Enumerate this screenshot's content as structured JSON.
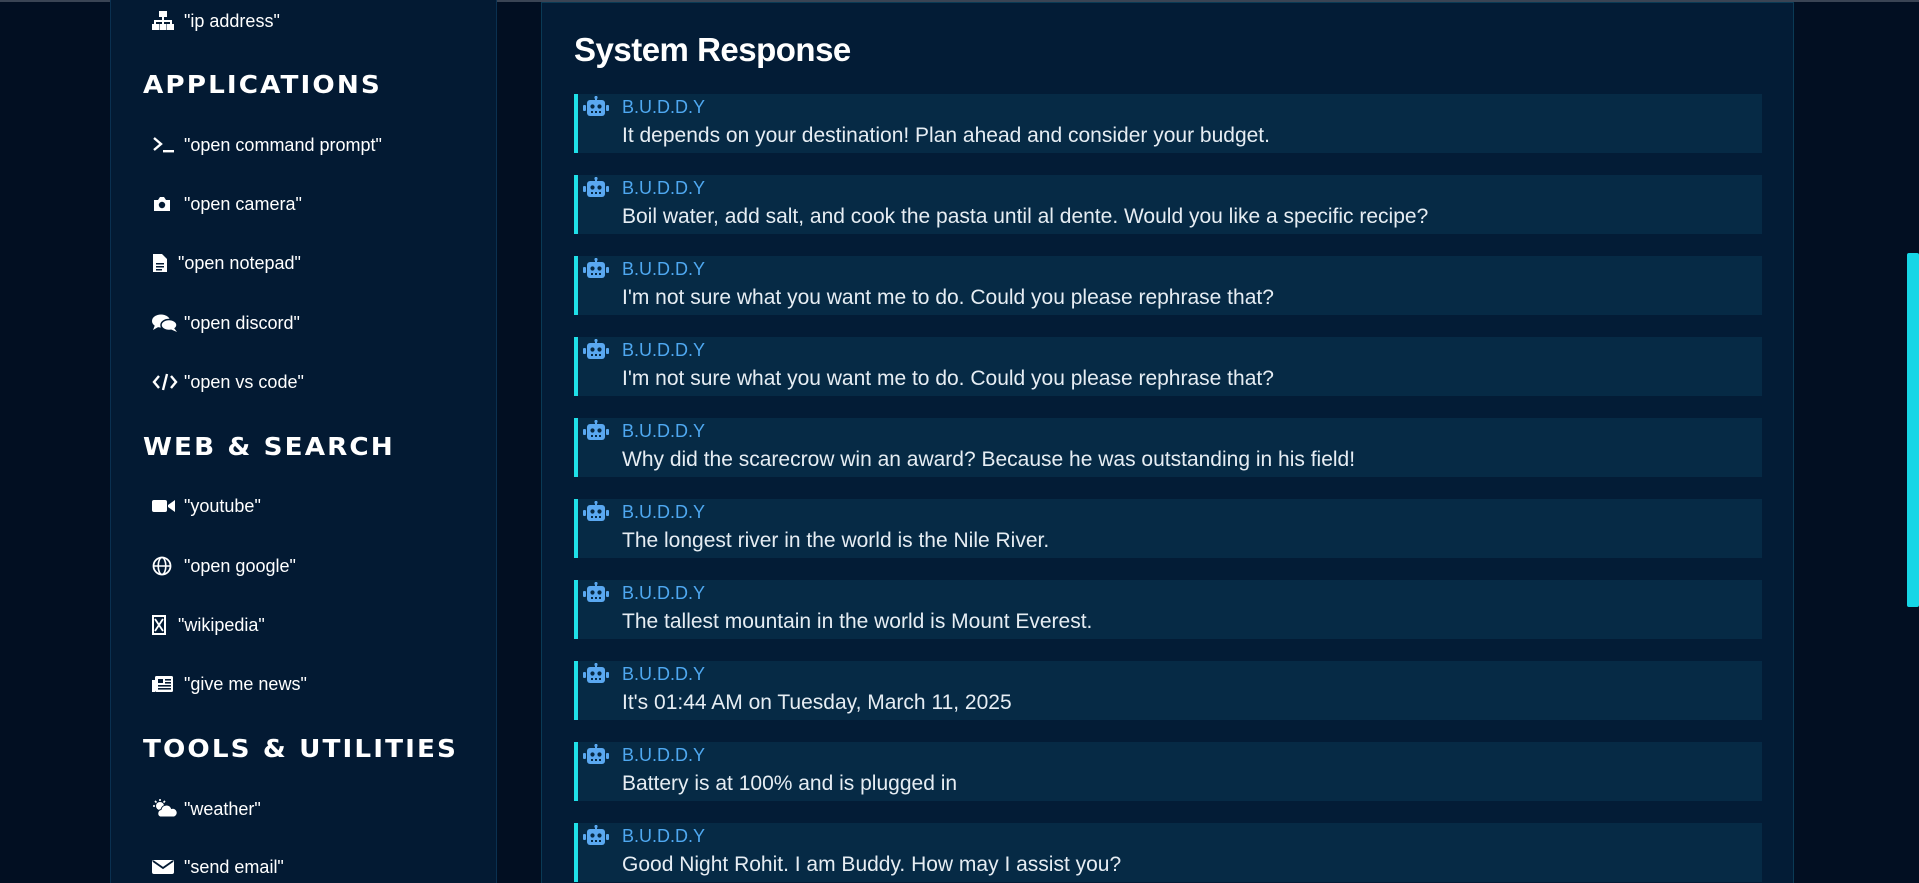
{
  "sidebar": {
    "top_item": {
      "label": "\"ip address\"",
      "icon": "network-icon"
    },
    "sections": [
      {
        "title": "APPLICATIONS",
        "items": [
          {
            "label": "\"open command prompt\"",
            "icon": "terminal-icon"
          },
          {
            "label": "\"open camera\"",
            "icon": "camera-icon"
          },
          {
            "label": "\"open notepad\"",
            "icon": "file-icon"
          },
          {
            "label": "\"open discord\"",
            "icon": "comments-icon"
          },
          {
            "label": "\"open vs code\"",
            "icon": "code-icon"
          }
        ]
      },
      {
        "title": "WEB & SEARCH",
        "items": [
          {
            "label": "\"youtube\"",
            "icon": "video-icon"
          },
          {
            "label": "\"open google\"",
            "icon": "globe-icon"
          },
          {
            "label": "\"wikipedia\"",
            "icon": "wikipedia-icon"
          },
          {
            "label": "\"give me news\"",
            "icon": "newspaper-icon"
          }
        ]
      },
      {
        "title": "TOOLS & UTILITIES",
        "items": [
          {
            "label": "\"weather\"",
            "icon": "cloud-sun-icon"
          },
          {
            "label": "\"send email\"",
            "icon": "envelope-icon"
          }
        ]
      }
    ]
  },
  "main": {
    "title": "System Response",
    "sender_name": "B.U.D.D.Y",
    "messages": [
      {
        "sender": "B.U.D.D.Y",
        "text": "It depends on your destination! Plan ahead and consider your budget."
      },
      {
        "sender": "B.U.D.D.Y",
        "text": "Boil water, add salt, and cook the pasta until al dente. Would you like a specific recipe?"
      },
      {
        "sender": "B.U.D.D.Y",
        "text": "I'm not sure what you want me to do. Could you please rephrase that?"
      },
      {
        "sender": "B.U.D.D.Y",
        "text": "I'm not sure what you want me to do. Could you please rephrase that?"
      },
      {
        "sender": "B.U.D.D.Y",
        "text": "Why did the scarecrow win an award? Because he was outstanding in his field!"
      },
      {
        "sender": "B.U.D.D.Y",
        "text": "The longest river in the world is the Nile River."
      },
      {
        "sender": "B.U.D.D.Y",
        "text": "The tallest mountain in the world is Mount Everest."
      },
      {
        "sender": "B.U.D.D.Y",
        "text": "It's 01:44 AM on Tuesday, March 11, 2025"
      },
      {
        "sender": "B.U.D.D.Y",
        "text": "Battery is at 100% and is plugged in"
      },
      {
        "sender": "B.U.D.D.Y",
        "text": "Good Night Rohit. I am Buddy. How may I assist you?"
      }
    ]
  },
  "colors": {
    "background": "#020f22",
    "panel": "#031c36",
    "message_bg": "#062a45",
    "accent": "#1fe0e8",
    "sender": "#4fa8f0",
    "bot_icon": "#5aa8f0"
  }
}
